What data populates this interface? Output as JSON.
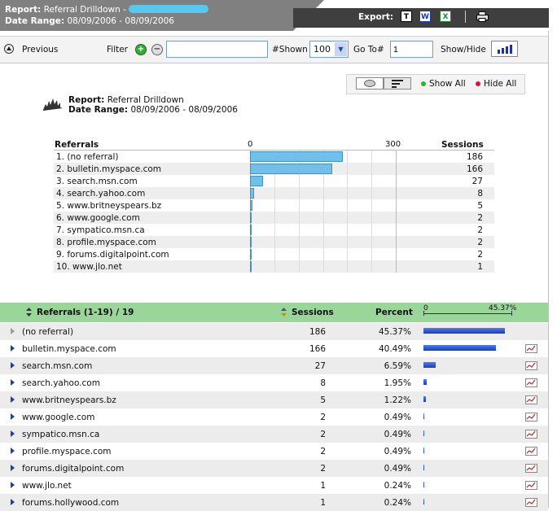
{
  "header": {
    "report_label": "Report:",
    "report_name": "Referral Drilldown -",
    "date_label": "Date Range:",
    "date_value": "08/09/2006 - 08/09/2006",
    "export_label": "Export:",
    "export_icons": [
      "text-export-icon",
      "word-export-icon",
      "excel-export-icon",
      "print-icon"
    ]
  },
  "toolbar": {
    "previous_label": "Previous",
    "filter_label": "Filter",
    "filter_value": "",
    "shown_label": "#Shown",
    "shown_value": "100",
    "goto_label": "Go To#",
    "goto_value": "1",
    "showhide_label": "Show/Hide"
  },
  "controls": {
    "show_all": "Show All",
    "hide_all": "Hide All",
    "colors": {
      "show": "#22bb22",
      "hide": "#e0103a"
    }
  },
  "subheader": {
    "report_label": "Report:",
    "report_value": "Referral Drilldown",
    "date_label": "Date Range:",
    "date_value": "08/09/2006 - 08/09/2006"
  },
  "chart_data": {
    "type": "bar",
    "orientation": "horizontal",
    "category_header": "Referrals",
    "value_header": "Sessions",
    "categories": [
      "1. (no referral)",
      "2. bulletin.myspace.com",
      "3. search.msn.com",
      "4. search.yahoo.com",
      "5. www.britneyspears.bz",
      "6. www.google.com",
      "7. sympatico.msn.ca",
      "8. profile.myspace.com",
      "9. forums.digitalpoint.com",
      "10. www.jlo.net"
    ],
    "values": [
      186,
      166,
      27,
      8,
      5,
      2,
      2,
      2,
      2,
      1
    ],
    "x_ticks": [
      "0",
      "300"
    ],
    "xlim": [
      0,
      300
    ],
    "colors": {
      "bar": "#6fc0ea"
    }
  },
  "grid": {
    "header": {
      "referrals_label": "Referrals",
      "range": "(1-19) / 19",
      "sessions_label": "Sessions",
      "percent_label": "Percent",
      "scale_min": "0",
      "scale_max": "45.37%"
    },
    "rows": [
      {
        "name": "(no referral)",
        "sessions": "186",
        "percent": "45.37%",
        "pct": 45.37,
        "expandable": false
      },
      {
        "name": "bulletin.myspace.com",
        "sessions": "166",
        "percent": "40.49%",
        "pct": 40.49,
        "expandable": true
      },
      {
        "name": "search.msn.com",
        "sessions": "27",
        "percent": "6.59%",
        "pct": 6.59,
        "expandable": true
      },
      {
        "name": "search.yahoo.com",
        "sessions": "8",
        "percent": "1.95%",
        "pct": 1.95,
        "expandable": true
      },
      {
        "name": "www.britneyspears.bz",
        "sessions": "5",
        "percent": "1.22%",
        "pct": 1.22,
        "expandable": true
      },
      {
        "name": "www.google.com",
        "sessions": "2",
        "percent": "0.49%",
        "pct": 0.49,
        "expandable": true
      },
      {
        "name": "sympatico.msn.ca",
        "sessions": "2",
        "percent": "0.49%",
        "pct": 0.49,
        "expandable": true
      },
      {
        "name": "profile.myspace.com",
        "sessions": "2",
        "percent": "0.49%",
        "pct": 0.49,
        "expandable": true
      },
      {
        "name": "forums.digitalpoint.com",
        "sessions": "2",
        "percent": "0.49%",
        "pct": 0.49,
        "expandable": true
      },
      {
        "name": "www.jlo.net",
        "sessions": "1",
        "percent": "0.24%",
        "pct": 0.24,
        "expandable": true
      },
      {
        "name": "forums.hollywood.com",
        "sessions": "1",
        "percent": "0.24%",
        "pct": 0.24,
        "expandable": true
      }
    ]
  }
}
